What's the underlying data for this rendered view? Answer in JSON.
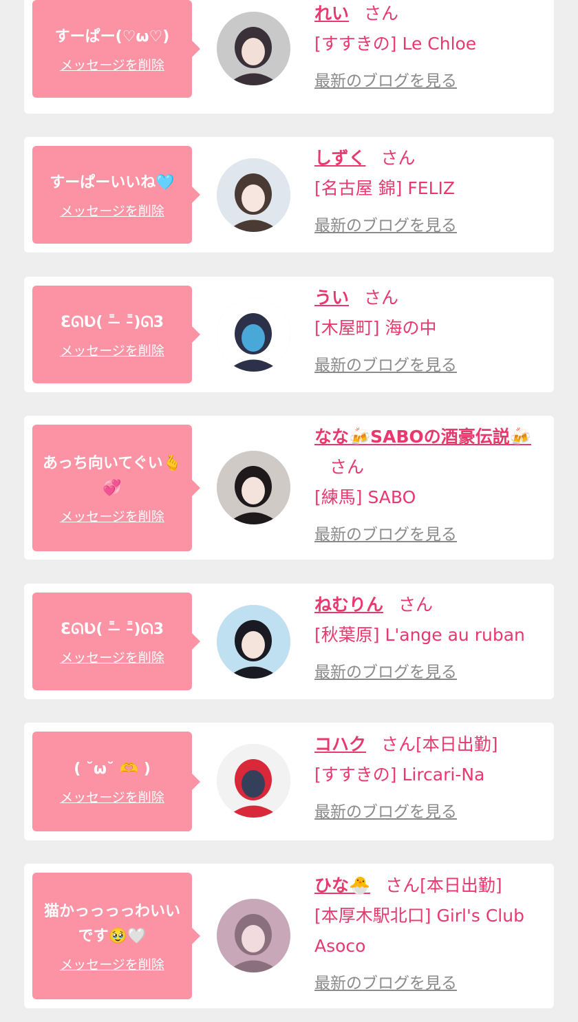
{
  "delete_label": "メッセージを削除",
  "blog_label": "最新のブログを見る",
  "san_label": "さん",
  "colors": {
    "background": "#eeeeee",
    "card": "#ffffff",
    "bubble": "#fb93a4",
    "accent": "#e8386e",
    "muted_link": "#8a8a8a"
  },
  "items": [
    {
      "message": "すーぱー(♡ω♡)",
      "name": "れい",
      "status": "",
      "shop": "[すすきの] Le Chloe",
      "avatar_icon": "user-photo-avatar",
      "avatar_colors": [
        "#c9c9c9",
        "#3a3038",
        "#f2dfd8"
      ]
    },
    {
      "message": "すーぱーいいね🩵",
      "name": "しずく",
      "status": "",
      "shop": "[名古屋 錦] FELIZ",
      "avatar_icon": "user-photo-avatar",
      "avatar_colors": [
        "#dfe6ee",
        "#4a3a34",
        "#f6e6df"
      ]
    },
    {
      "message": "ƐᘏƲ( ˭̵̵̵̵ ̵̵̵̵ ˭̵̵̵̵)ᘏ3",
      "name": "うい",
      "status": "",
      "shop": "[木屋町] 海の中",
      "avatar_icon": "user-photo-avatar",
      "avatar_colors": [
        "#ffffff",
        "#2c3048",
        "#4aa8d8"
      ]
    },
    {
      "message": "あっち向いてぐい🫰💞",
      "name": "なな🍻SABOの酒豪伝説🍻",
      "status": "",
      "shop": "[練馬] SABO",
      "avatar_icon": "user-photo-avatar",
      "avatar_colors": [
        "#cfcac6",
        "#1e1a1c",
        "#f4e3dc"
      ]
    },
    {
      "message": "ƐᘏƲ( ˭̵̵̵̵ ̵̵̵̵ ˭̵̵̵̵)ᘏ3",
      "name": "ねむりん",
      "status": "",
      "shop": "[秋葉原] L'ange au ruban",
      "avatar_icon": "user-photo-avatar",
      "avatar_colors": [
        "#bfe0f0",
        "#1a1a22",
        "#f5e4dc"
      ]
    },
    {
      "message": "( ˘ω˘ 🫶 )",
      "name": "コハク",
      "status": "[本日出勤]",
      "shop": "[すすきの] Lircari-Na",
      "avatar_icon": "user-photo-avatar",
      "avatar_colors": [
        "#f2f2f2",
        "#d8283a",
        "#34405a"
      ]
    },
    {
      "message": "猫かっっっっわいいです🥹🤍",
      "name": "ひな🐣",
      "status": "[本日出勤]",
      "shop": "[本厚木駅北口] Girl's Club Asoco",
      "avatar_icon": "user-photo-avatar",
      "avatar_colors": [
        "#c8a7b8",
        "#8a6f7c",
        "#f0dcdf"
      ]
    }
  ]
}
